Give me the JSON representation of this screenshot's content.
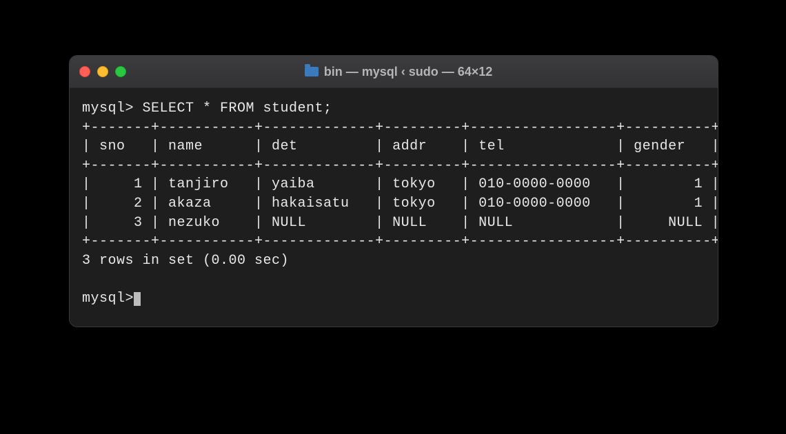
{
  "window": {
    "title": "bin — mysql ‹ sudo — 64×12"
  },
  "terminal": {
    "prompt": "mysql>",
    "query": "SELECT * FROM student;",
    "row_count_msg": "3 rows in set (0.00 sec)"
  },
  "table": {
    "columns": [
      {
        "name": "sno",
        "width": 5,
        "align": "right"
      },
      {
        "name": "name",
        "width": 9,
        "align": "left"
      },
      {
        "name": "det",
        "width": 11,
        "align": "left"
      },
      {
        "name": "addr",
        "width": 7,
        "align": "left"
      },
      {
        "name": "tel",
        "width": 15,
        "align": "left"
      },
      {
        "name": "gender",
        "width": 8,
        "align": "right"
      }
    ],
    "rows": [
      {
        "sno": "1",
        "name": "tanjiro",
        "det": "yaiba",
        "addr": "tokyo",
        "tel": "010-0000-0000",
        "gender": "1"
      },
      {
        "sno": "2",
        "name": "akaza",
        "det": "hakaisatu",
        "addr": "tokyo",
        "tel": "010-0000-0000",
        "gender": "1"
      },
      {
        "sno": "3",
        "name": "nezuko",
        "det": "NULL",
        "addr": "NULL",
        "tel": "NULL",
        "gender": "NULL"
      }
    ]
  },
  "render": {}
}
